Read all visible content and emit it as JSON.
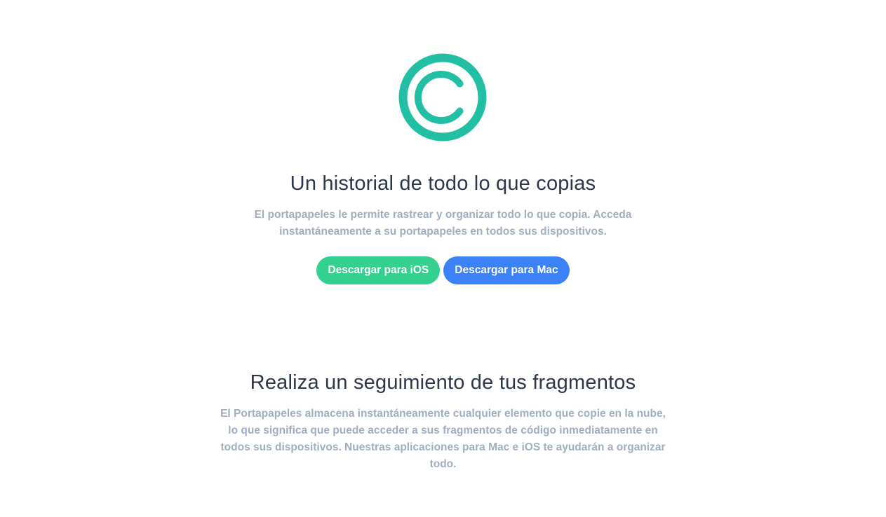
{
  "brand": {
    "icon": "copyright-icon",
    "accent_color": "#22bfa5"
  },
  "hero": {
    "title": "Un historial de todo lo que copias",
    "description": "El portapapeles le permite rastrear y organizar todo lo que copia. Acceda instantáneamente a su portapapeles en todos sus dispositivos.",
    "buttons": [
      {
        "label": "Descargar para iOS",
        "color": "#33d08f"
      },
      {
        "label": "Descargar para Mac",
        "color": "#3b82f6"
      }
    ]
  },
  "feature": {
    "title": "Realiza un seguimiento de tus fragmentos",
    "description": "El Portapapeles almacena instantáneamente cualquier elemento que copie en la nube, lo que significa que puede acceder a sus fragmentos de código inmediatamente en todos sus dispositivos. Nuestras aplicaciones para Mac e iOS te ayudarán a organizar todo."
  }
}
